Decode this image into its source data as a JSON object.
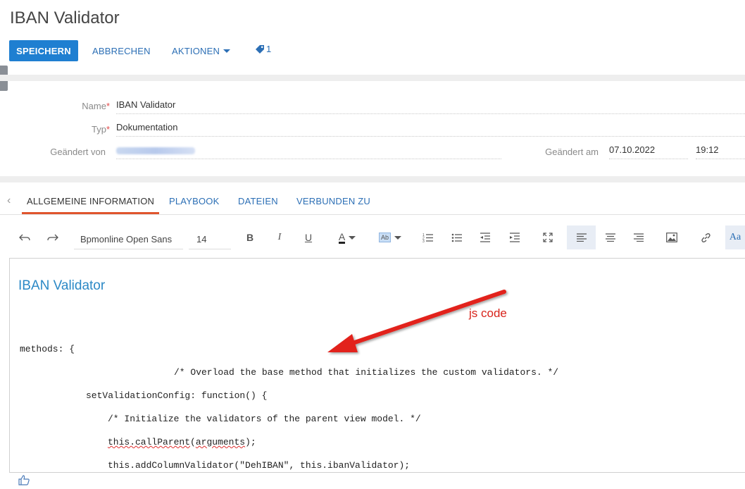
{
  "page": {
    "title": "IBAN Validator"
  },
  "actions": {
    "save": "SPEICHERN",
    "cancel": "ABBRECHEN",
    "actions": "AKTIONEN",
    "tag_count": "1"
  },
  "fields": {
    "name": {
      "label": "Name",
      "required": "*",
      "value": "IBAN Validator"
    },
    "type": {
      "label": "Typ",
      "required": "*",
      "value": "Dokumentation"
    },
    "changed_by": {
      "label": "Geändert von"
    },
    "changed_at": {
      "label": "Geändert am",
      "date": "07.10.2022",
      "time": "19:12"
    }
  },
  "tabs": [
    "ALLGEMEINE INFORMATION",
    "PLAYBOOK",
    "DATEIEN",
    "VERBUNDEN ZU"
  ],
  "toolbar": {
    "font": "Bpmonline Open Sans",
    "size": "14",
    "bold": "B",
    "italic": "I",
    "underline": "U",
    "text_color": "A",
    "highlight": "Ab",
    "style": "Aa"
  },
  "editor": {
    "heading": "IBAN Validator",
    "code": {
      "l1": "methods: {",
      "l2": "/* Overload the base method that initializes the custom validators. */",
      "l3": "setValidationConfig: function() {",
      "l4": "/* Initialize the validators of the parent view model. */",
      "l5a": "this.callParent",
      "l5b": "(",
      "l5c": "arguments",
      "l5d": ");",
      "l6": "this.addColumnValidator(\"DehIBAN\", this.ibanValidator);"
    }
  },
  "annotation": {
    "text": "js code",
    "color": "#d8241b"
  },
  "colors": {
    "primary": "#1f7fd1",
    "link": "#2c6fb5",
    "tab_active": "#e0552d",
    "heading": "#2c89c6"
  },
  "icons": [
    "undo-icon",
    "redo-icon",
    "ordered-list-icon",
    "bullet-list-icon",
    "outdent-icon",
    "indent-icon",
    "fullscreen-icon",
    "align-left-icon",
    "align-center-icon",
    "align-right-icon",
    "image-icon",
    "link-icon",
    "tag-icon",
    "like-icon"
  ]
}
